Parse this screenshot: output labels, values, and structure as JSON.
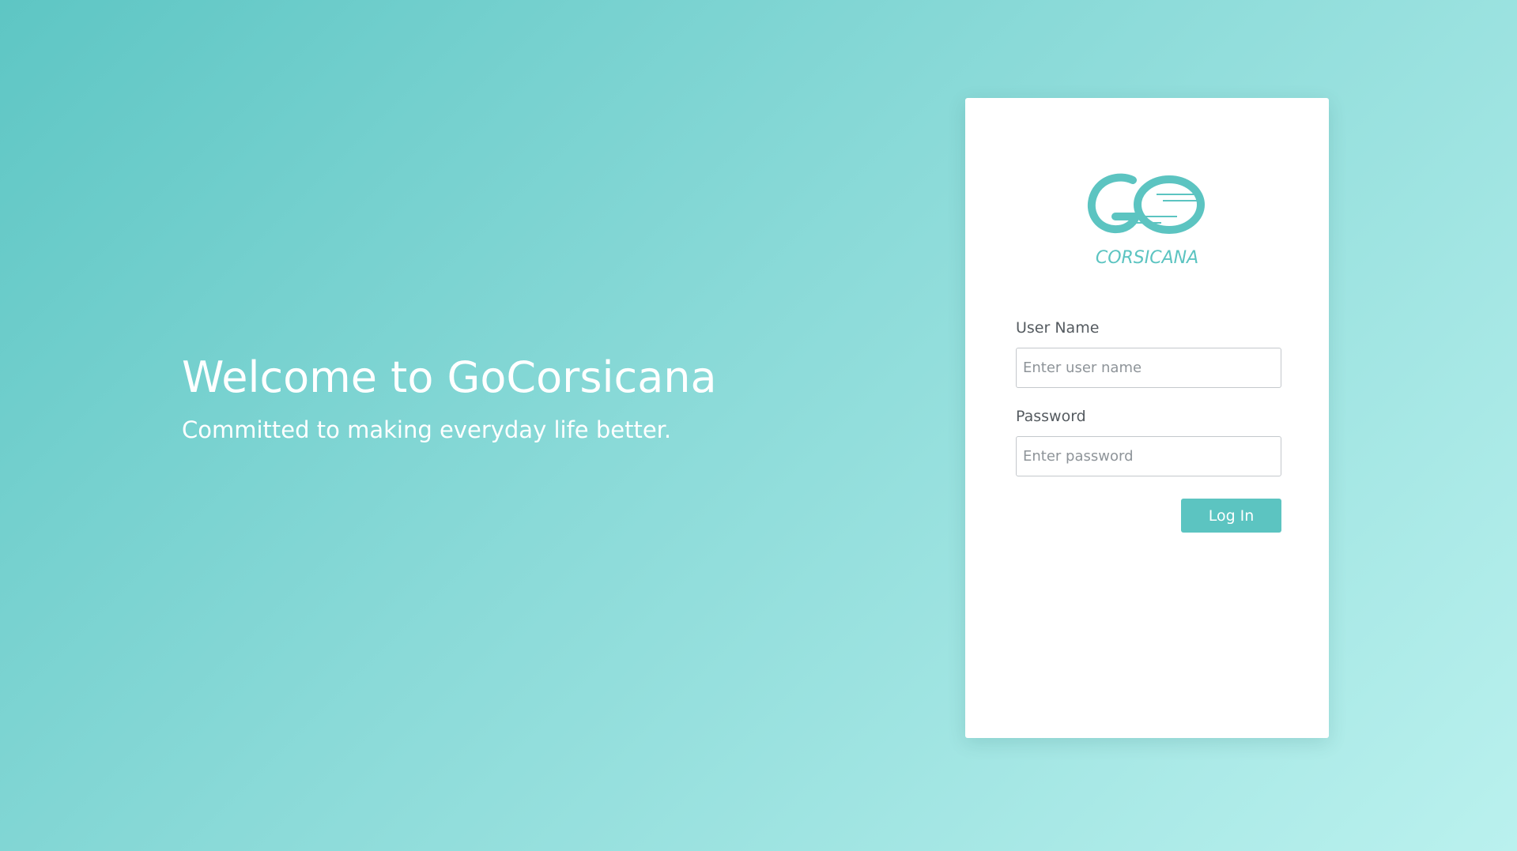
{
  "hero": {
    "title": "Welcome to GoCorsicana",
    "subtitle": "Committed to making everyday life better."
  },
  "logo": {
    "icon": "go-logo-icon",
    "wordmark": "CORSICANA"
  },
  "form": {
    "username_label": "User Name",
    "username_placeholder": "Enter user name",
    "username_value": "",
    "password_label": "Password",
    "password_placeholder": "Enter password",
    "password_value": "",
    "login_label": "Log In"
  },
  "colors": {
    "accent": "#5cc4c1",
    "background_start": "#5ec6c4",
    "background_end": "#baf1ee",
    "card": "#ffffff",
    "label_text": "#555b60"
  }
}
